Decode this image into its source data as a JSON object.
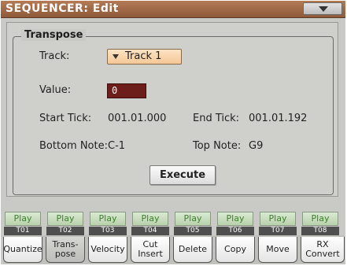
{
  "window": {
    "title": "SEQUENCER: Edit"
  },
  "group": {
    "title": "Transpose"
  },
  "track": {
    "label": "Track:",
    "value": "Track 1"
  },
  "value": {
    "label": "Value:",
    "current": "0"
  },
  "start_tick": {
    "label": "Start Tick:",
    "value": "001.01.000"
  },
  "end_tick": {
    "label": "End Tick:",
    "value": "001.01.192"
  },
  "bottom_note": {
    "label": "Bottom Note:",
    "value": "C-1"
  },
  "top_note": {
    "label": "Top Note:",
    "value": "G9"
  },
  "execute_label": "Execute",
  "tracks": [
    {
      "play": "Play",
      "id": "T01"
    },
    {
      "play": "Play",
      "id": "T02"
    },
    {
      "play": "Play",
      "id": "T03"
    },
    {
      "play": "Play",
      "id": "T04"
    },
    {
      "play": "Play",
      "id": "T05"
    },
    {
      "play": "Play",
      "id": "T06"
    },
    {
      "play": "Play",
      "id": "T07"
    },
    {
      "play": "Play",
      "id": "T08"
    }
  ],
  "tabs": [
    {
      "label": "Quantize"
    },
    {
      "label": "Trans-\npose"
    },
    {
      "label": "Velocity"
    },
    {
      "label": "Cut\nInsert"
    },
    {
      "label": "Delete"
    },
    {
      "label": "Copy"
    },
    {
      "label": "Move"
    },
    {
      "label": "RX\nConvert"
    }
  ],
  "colors": {
    "title_bar": "#9f6946",
    "value_field": "#6e1e1a",
    "track_button": "#f4c897",
    "play_text": "#3f7f2f"
  },
  "icons": {
    "menu": "menu-arrow-icon",
    "dropdown": "dropdown-arrow-icon"
  }
}
